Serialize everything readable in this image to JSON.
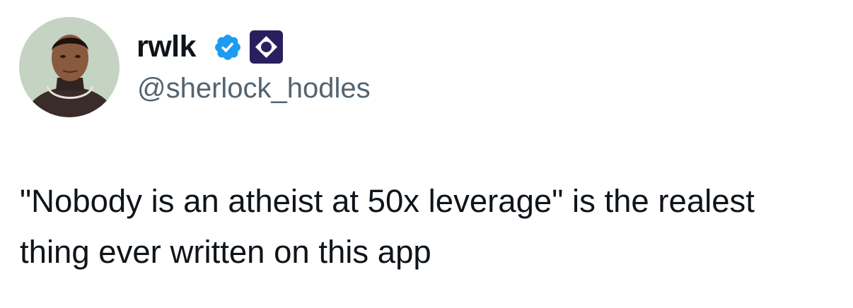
{
  "author": {
    "display_name": "rwlk",
    "handle": "@sherlock_hodles",
    "verified_icon": "verified-badge-icon",
    "affiliate_icon": "affiliate-org-badge-icon",
    "avatar": "profile-photo"
  },
  "tweet": {
    "text": "\"Nobody is an atheist at 50x leverage\" is the realest thing ever written on this app"
  },
  "colors": {
    "text_primary": "#0f1419",
    "text_secondary": "#536471",
    "verified_blue": "#1d9bf0",
    "affiliate_badge": "#2a1f5e"
  }
}
